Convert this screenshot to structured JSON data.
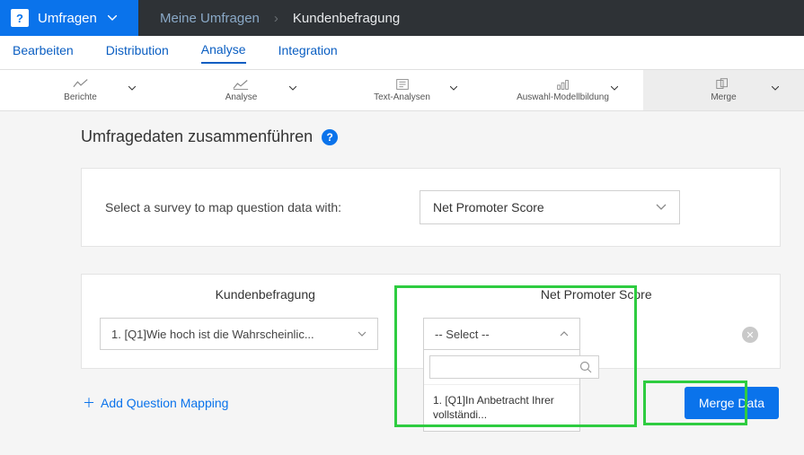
{
  "brand": {
    "label": "Umfragen"
  },
  "breadcrumb": {
    "parent": "Meine Umfragen",
    "current": "Kundenbefragung"
  },
  "tabs": {
    "edit": "Bearbeiten",
    "distribution": "Distribution",
    "analyse": "Analyse",
    "integration": "Integration"
  },
  "toolbar": {
    "reports": "Berichte",
    "analyse": "Analyse",
    "text": "Text-Analysen",
    "choice": "Auswahl-Modellbildung",
    "merge": "Merge"
  },
  "panel": {
    "title": "Umfragedaten zusammenführen",
    "select_label": "Select a survey to map question data with:",
    "survey_selected": "Net Promoter Score"
  },
  "mapping": {
    "left_header": "Kundenbefragung",
    "right_header": "Net Promoter Score",
    "left_value": "1. [Q1]Wie hoch ist die Wahrscheinlic...",
    "right_value": "-- Select --",
    "dropdown_option": "1. [Q1]In Anbetracht Ihrer vollständi...",
    "search_placeholder": ""
  },
  "actions": {
    "add_mapping": "Add Question Mapping",
    "merge_button": "Merge Data"
  }
}
